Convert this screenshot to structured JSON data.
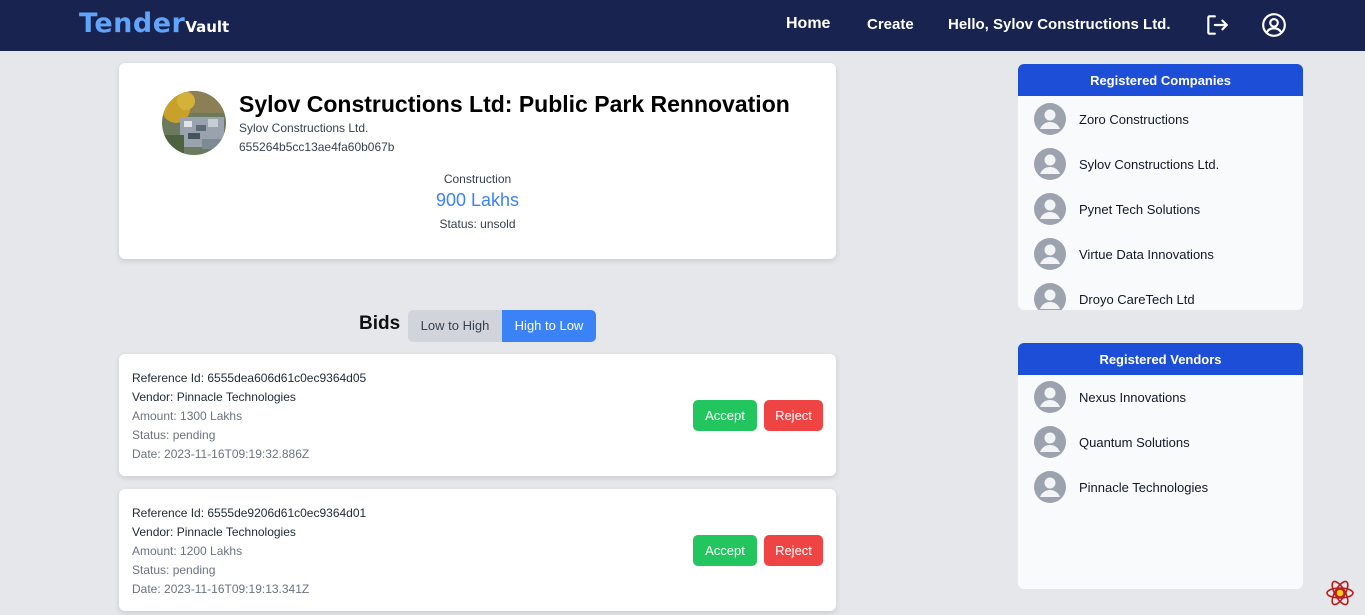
{
  "nav": {
    "brand_main": "Tender",
    "brand_sub": "Vault",
    "home": "Home",
    "create": "Create",
    "greeting": "Hello, Sylov Constructions Ltd.",
    "logout_icon": "logout-icon",
    "profile_icon": "user-circle-icon"
  },
  "tender": {
    "title": "Sylov Constructions Ltd: Public Park Rennovation",
    "company": "Sylov Constructions Ltd.",
    "id": "655264b5cc13ae4fa60b067b",
    "category": "Construction",
    "amount": "900 Lakhs",
    "status": "Status: unsold"
  },
  "bids": {
    "title": "Bids",
    "sort_low": "Low to High",
    "sort_high": "High to Low",
    "items": [
      {
        "reference": "Reference Id: 6555dea606d61c0ec9364d05",
        "vendor": "Vendor: Pinnacle Technologies",
        "amount": "Amount: 1300 Lakhs",
        "status": "Status: pending",
        "date": "Date: 2023-11-16T09:19:32.886Z",
        "accept": "Accept",
        "reject": "Reject"
      },
      {
        "reference": "Reference Id: 6555de9206d61c0ec9364d01",
        "vendor": "Vendor: Pinnacle Technologies",
        "amount": "Amount: 1200 Lakhs",
        "status": "Status: pending",
        "date": "Date: 2023-11-16T09:19:13.341Z",
        "accept": "Accept",
        "reject": "Reject"
      }
    ]
  },
  "companies": {
    "title": "Registered Companies",
    "items": [
      "Zoro Constructions",
      "Sylov Constructions Ltd.",
      "Pynet Tech Solutions",
      "Virtue Data Innovations",
      "Droyo CareTech Ltd"
    ]
  },
  "vendors": {
    "title": "Registered Vendors",
    "items": [
      "Nexus Innovations",
      "Quantum Solutions",
      "Pinnacle Technologies"
    ]
  },
  "colors": {
    "navbar": "#18244f",
    "brand": "#60a5fa",
    "accent": "#3b82f6",
    "panel_header": "#1d4ed8",
    "accept": "#22c55e",
    "reject": "#ef4444"
  }
}
